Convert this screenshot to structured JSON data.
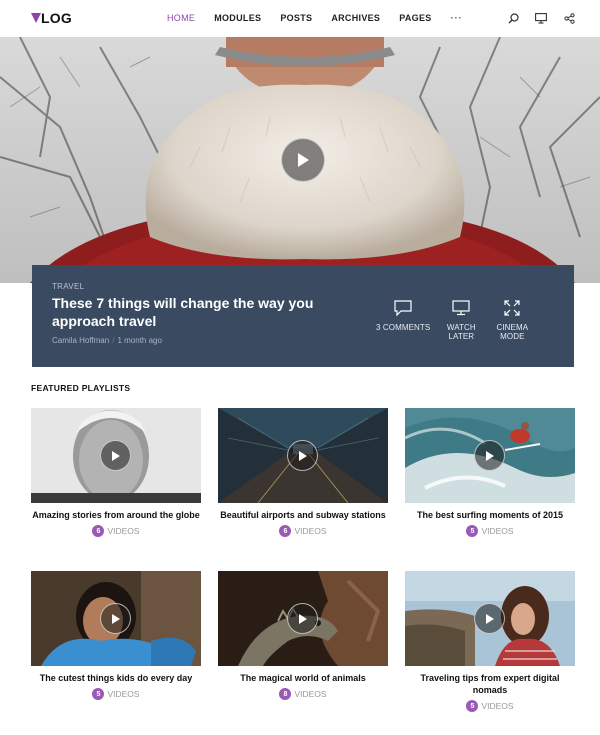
{
  "header": {
    "logo_text": "LOG",
    "nav": [
      "HOME",
      "MODULES",
      "POSTS",
      "ARCHIVES",
      "PAGES"
    ],
    "nav_more": "···",
    "icons": [
      "search-icon",
      "monitor-icon",
      "share-icon"
    ]
  },
  "hero": {
    "category": "TRAVEL",
    "title": "These 7 things will change the way you approach travel",
    "author": "Camila Hoffman",
    "time": "1 month ago",
    "actions": [
      {
        "label": "3 COMMENTS",
        "icon": "comment-icon"
      },
      {
        "label": "WATCH LATER",
        "icon": "monitor-icon"
      },
      {
        "label": "CINEMA MODE",
        "icon": "expand-icon"
      }
    ]
  },
  "featured": {
    "title": "FEATURED PLAYLISTS",
    "playlists": [
      {
        "title": "Amazing stories from around the globe",
        "count": "6",
        "unit": "VIDEOS"
      },
      {
        "title": "Beautiful airports and subway stations",
        "count": "6",
        "unit": "VIDEOS"
      },
      {
        "title": "The best surfing moments of 2015",
        "count": "5",
        "unit": "VIDEOS"
      },
      {
        "title": "The cutest things kids do every day",
        "count": "5",
        "unit": "VIDEOS"
      },
      {
        "title": "The magical world of animals",
        "count": "8",
        "unit": "VIDEOS"
      },
      {
        "title": "Traveling tips from expert digital nomads",
        "count": "5",
        "unit": "VIDEOS"
      }
    ]
  },
  "colors": {
    "accent": "#8e44ad",
    "card": "#3a4a60",
    "badge": "#9b59b6"
  }
}
